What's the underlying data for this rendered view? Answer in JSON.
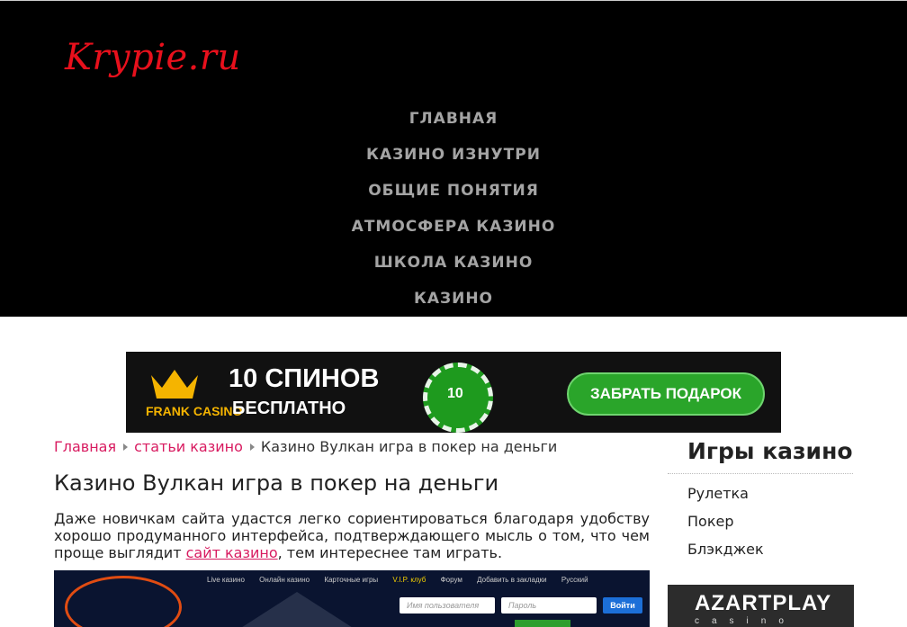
{
  "header": {
    "logo": "Krypie.ru",
    "nav": [
      "ГЛАВНАЯ",
      "КАЗИНО ИЗНУТРИ",
      "ОБЩИЕ ПОНЯТИЯ",
      "АТМОСФЕРА КАЗИНО",
      "ШКОЛА КАЗИНО",
      "КАЗИНО"
    ]
  },
  "banner": {
    "brand": "FRANK CASINO",
    "headline": "10 СПИНОВ",
    "subline": "БЕСПЛАТНО",
    "chip": "10",
    "cta": "ЗАБРАТЬ ПОДАРОК"
  },
  "breadcrumbs": {
    "home": "Главная",
    "category": "статьи казино",
    "current": "Казино Вулкан игра в покер на деньги"
  },
  "article": {
    "title": "Казино Вулкан игра в покер на деньги",
    "intro_before": "Даже новичкам сайта удастся легко сориентироваться благодаря удобству хорошо продуманного интерфейса, подтверждающего мысль о том, что чем проще выглядит ",
    "intro_link": "сайт казино",
    "intro_after": ", тем интереснее там играть."
  },
  "screenshot": {
    "nav": [
      "Live казино",
      "Онлайн казино",
      "Карточные игры",
      "V.I.P. клуб",
      "Форум",
      "Добавить в закладки",
      "Русский"
    ],
    "username_placeholder": "Имя пользователя",
    "password_placeholder": "Пароль",
    "login": "Войти"
  },
  "sidebar": {
    "title": "Игры казино",
    "links": [
      "Рулетка",
      "Покер",
      "Блэкджек"
    ]
  },
  "ad2": {
    "title": "AZARTPLAY",
    "subtitle": "casino"
  }
}
